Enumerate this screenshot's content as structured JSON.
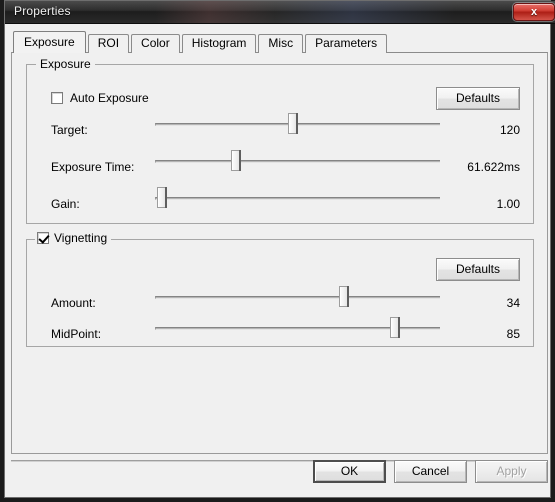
{
  "window": {
    "title": "Properties",
    "close_label": "x",
    "close_icon": "close-icon"
  },
  "tabs": [
    {
      "label": "Exposure",
      "active": true
    },
    {
      "label": "ROI",
      "active": false
    },
    {
      "label": "Color",
      "active": false
    },
    {
      "label": "Histogram",
      "active": false
    },
    {
      "label": "Misc",
      "active": false
    },
    {
      "label": "Parameters",
      "active": false
    }
  ],
  "exposure_group": {
    "title": "Exposure",
    "auto_exposure": {
      "label": "Auto Exposure",
      "checked": false
    },
    "defaults_label": "Defaults",
    "sliders": [
      {
        "label": "Target:",
        "value": "120",
        "position_pct": 48
      },
      {
        "label": "Exposure Time:",
        "value": "61.622ms",
        "position_pct": 28
      },
      {
        "label": "Gain:",
        "value": "1.00",
        "position_pct": 2
      }
    ]
  },
  "vignetting_group": {
    "title": "Vignetting",
    "checked": true,
    "defaults_label": "Defaults",
    "sliders": [
      {
        "label": "Amount:",
        "value": "34",
        "position_pct": 66
      },
      {
        "label": "MidPoint:",
        "value": "85",
        "position_pct": 84
      }
    ]
  },
  "footer": {
    "ok_label": "OK",
    "cancel_label": "Cancel",
    "apply_label": "Apply",
    "apply_enabled": false
  },
  "colors": {
    "dialog_bg": "#f0f0f0",
    "titlebar": "#2a2a2a",
    "close_red": "#c32b20",
    "text": "#000000",
    "disabled_text": "#a2a2a2"
  }
}
